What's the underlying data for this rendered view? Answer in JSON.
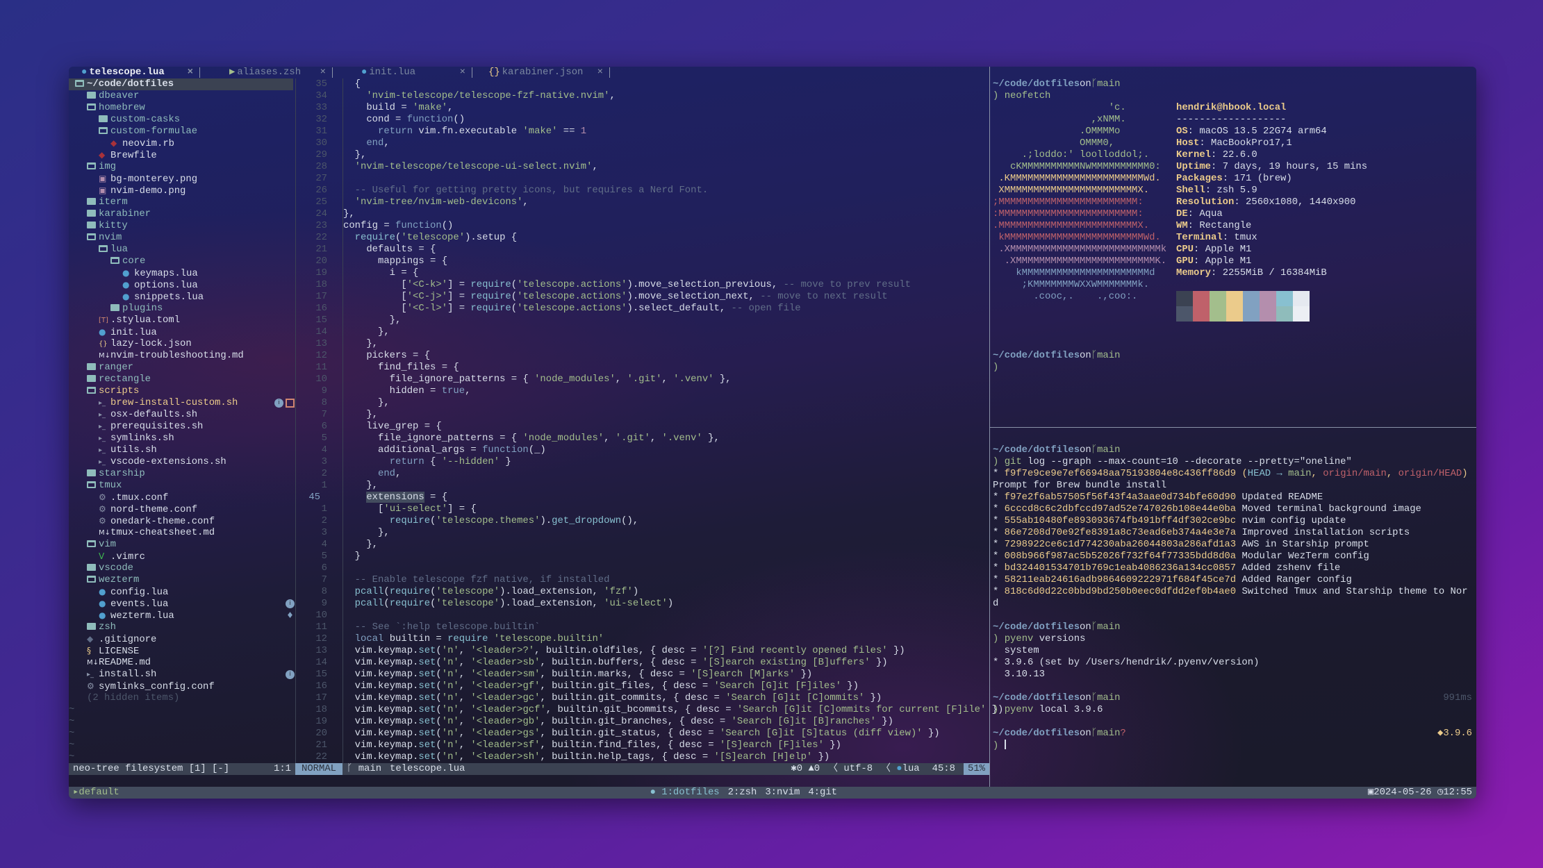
{
  "tabs": [
    {
      "label": "telescope.lua",
      "icon": "lua-icon",
      "active": true
    },
    {
      "label": "aliases.zsh",
      "icon": "terminal-icon",
      "active": false
    },
    {
      "label": "init.lua",
      "icon": "lua-icon",
      "active": false
    },
    {
      "label": "karabiner.json",
      "icon": "json-icon",
      "active": false
    }
  ],
  "tab_close_glyph": "×",
  "tree": {
    "items": [
      {
        "name": "~/code/dotfiles",
        "level": 0,
        "type": "root"
      },
      {
        "name": "dbeaver",
        "level": 1,
        "type": "dir"
      },
      {
        "name": "homebrew",
        "level": 1,
        "type": "dir-open"
      },
      {
        "name": "custom-casks",
        "level": 2,
        "type": "dir"
      },
      {
        "name": "custom-formulae",
        "level": 2,
        "type": "dir-open"
      },
      {
        "name": "neovim.rb",
        "level": 3,
        "type": "ruby"
      },
      {
        "name": "Brewfile",
        "level": 2,
        "type": "ruby"
      },
      {
        "name": "img",
        "level": 1,
        "type": "dir-open"
      },
      {
        "name": "bg-monterey.png",
        "level": 2,
        "type": "image"
      },
      {
        "name": "nvim-demo.png",
        "level": 2,
        "type": "image"
      },
      {
        "name": "iterm",
        "level": 1,
        "type": "dir"
      },
      {
        "name": "karabiner",
        "level": 1,
        "type": "dir"
      },
      {
        "name": "kitty",
        "level": 1,
        "type": "dir"
      },
      {
        "name": "nvim",
        "level": 1,
        "type": "dir-open"
      },
      {
        "name": "lua",
        "level": 2,
        "type": "dir-open"
      },
      {
        "name": "core",
        "level": 3,
        "type": "dir-open"
      },
      {
        "name": "keymaps.lua",
        "level": 4,
        "type": "lua"
      },
      {
        "name": "options.lua",
        "level": 4,
        "type": "lua"
      },
      {
        "name": "snippets.lua",
        "level": 4,
        "type": "lua"
      },
      {
        "name": "plugins",
        "level": 3,
        "type": "dir"
      },
      {
        "name": ".stylua.toml",
        "level": 2,
        "type": "toml"
      },
      {
        "name": "init.lua",
        "level": 2,
        "type": "lua"
      },
      {
        "name": "lazy-lock.json",
        "level": 2,
        "type": "json"
      },
      {
        "name": "nvim-troubleshooting.md",
        "level": 2,
        "type": "md"
      },
      {
        "name": "ranger",
        "level": 1,
        "type": "dir"
      },
      {
        "name": "rectangle",
        "level": 1,
        "type": "dir"
      },
      {
        "name": "scripts",
        "level": 1,
        "type": "dir-open",
        "modified": true
      },
      {
        "name": "brew-install-custom.sh",
        "level": 2,
        "type": "sh",
        "modified": true,
        "badges": [
          "info",
          "unsaved"
        ]
      },
      {
        "name": "osx-defaults.sh",
        "level": 2,
        "type": "sh"
      },
      {
        "name": "prerequisites.sh",
        "level": 2,
        "type": "sh"
      },
      {
        "name": "symlinks.sh",
        "level": 2,
        "type": "sh"
      },
      {
        "name": "utils.sh",
        "level": 2,
        "type": "sh"
      },
      {
        "name": "vscode-extensions.sh",
        "level": 2,
        "type": "sh"
      },
      {
        "name": "starship",
        "level": 1,
        "type": "dir"
      },
      {
        "name": "tmux",
        "level": 1,
        "type": "dir-open"
      },
      {
        "name": ".tmux.conf",
        "level": 2,
        "type": "conf"
      },
      {
        "name": "nord-theme.conf",
        "level": 2,
        "type": "conf"
      },
      {
        "name": "onedark-theme.conf",
        "level": 2,
        "type": "conf"
      },
      {
        "name": "tmux-cheatsheet.md",
        "level": 2,
        "type": "md"
      },
      {
        "name": "vim",
        "level": 1,
        "type": "dir-open"
      },
      {
        "name": ".vimrc",
        "level": 2,
        "type": "vim"
      },
      {
        "name": "vscode",
        "level": 1,
        "type": "dir"
      },
      {
        "name": "wezterm",
        "level": 1,
        "type": "dir-open"
      },
      {
        "name": "config.lua",
        "level": 2,
        "type": "lua"
      },
      {
        "name": "events.lua",
        "level": 2,
        "type": "lua",
        "badges": [
          "info"
        ]
      },
      {
        "name": "wezterm.lua",
        "level": 2,
        "type": "lua",
        "badges": [
          "hint"
        ]
      },
      {
        "name": "zsh",
        "level": 1,
        "type": "dir"
      },
      {
        "name": ".gitignore",
        "level": 1,
        "type": "git"
      },
      {
        "name": "LICENSE",
        "level": 1,
        "type": "license"
      },
      {
        "name": "README.md",
        "level": 1,
        "type": "md"
      },
      {
        "name": "install.sh",
        "level": 1,
        "type": "sh",
        "badges": [
          "info"
        ]
      },
      {
        "name": "symlinks_config.conf",
        "level": 1,
        "type": "conf"
      },
      {
        "name": "(2 hidden items)",
        "level": 1,
        "type": "hidden"
      }
    ],
    "filler": "~"
  },
  "editor": {
    "line_numbers": [
      35,
      34,
      33,
      32,
      31,
      30,
      29,
      28,
      27,
      26,
      25,
      24,
      23,
      22,
      21,
      20,
      19,
      18,
      17,
      16,
      15,
      14,
      13,
      12,
      11,
      10,
      9,
      8,
      7,
      6,
      5,
      4,
      3,
      2,
      1,
      45,
      1,
      2,
      3,
      4,
      5,
      6,
      7,
      8,
      9,
      10,
      11,
      12,
      13,
      14,
      15,
      16,
      17,
      18,
      19,
      20,
      21,
      22
    ],
    "cursor_line": 45,
    "cursor_word": "extensions",
    "lines": [
      "  {",
      "    'nvim-telescope/telescope-fzf-native.nvim',",
      "    build = 'make',",
      "    cond = function()",
      "      return vim.fn.executable 'make' == 1",
      "    end,",
      "  },",
      "  'nvim-telescope/telescope-ui-select.nvim',",
      "",
      "  -- Useful for getting pretty icons, but requires a Nerd Font.",
      "  'nvim-tree/nvim-web-devicons',",
      "},",
      "config = function()",
      "  require('telescope').setup {",
      "    defaults = {",
      "      mappings = {",
      "        i = {",
      "          ['<C-k>'] = require('telescope.actions').move_selection_previous, -- move to prev result",
      "          ['<C-j>'] = require('telescope.actions').move_selection_next, -- move to next result",
      "          ['<C-l>'] = require('telescope.actions').select_default, -- open file",
      "        },",
      "      },",
      "    },",
      "    pickers = {",
      "      find_files = {",
      "        file_ignore_patterns = { 'node_modules', '.git', '.venv' },",
      "        hidden = true,",
      "      },",
      "    },",
      "    live_grep = {",
      "      file_ignore_patterns = { 'node_modules', '.git', '.venv' },",
      "      additional_args = function(_)",
      "        return { '--hidden' }",
      "      end,",
      "    },",
      "    extensions = {",
      "      ['ui-select'] = {",
      "        require('telescope.themes').get_dropdown(),",
      "      },",
      "    },",
      "  }",
      "",
      "  -- Enable telescope fzf native, if installed",
      "  pcall(require('telescope').load_extension, 'fzf')",
      "  pcall(require('telescope').load_extension, 'ui-select')",
      "",
      "  -- See `:help telescope.builtin`",
      "  local builtin = require 'telescope.builtin'",
      "  vim.keymap.set('n', '<leader>?', builtin.oldfiles, { desc = '[?] Find recently opened files' })",
      "  vim.keymap.set('n', '<leader>sb', builtin.buffers, { desc = '[S]earch existing [B]uffers' })",
      "  vim.keymap.set('n', '<leader>sm', builtin.marks, { desc = '[S]earch [M]arks' })",
      "  vim.keymap.set('n', '<leader>gf', builtin.git_files, { desc = 'Search [G]it [F]iles' })",
      "  vim.keymap.set('n', '<leader>gc', builtin.git_commits, { desc = 'Search [G]it [C]ommits' })",
      "  vim.keymap.set('n', '<leader>gcf', builtin.git_bcommits, { desc = 'Search [G]it [C]ommits for current [F]ile' })",
      "  vim.keymap.set('n', '<leader>gb', builtin.git_branches, { desc = 'Search [G]it [B]ranches' })",
      "  vim.keymap.set('n', '<leader>gs', builtin.git_status, { desc = 'Search [G]it [S]tatus (diff view)' })",
      "  vim.keymap.set('n', '<leader>sf', builtin.find_files, { desc = '[S]earch [F]iles' })",
      "  vim.keymap.set('n', '<leader>sh', builtin.help_tags, { desc = '[S]earch [H]elp' })"
    ]
  },
  "nvim_status": {
    "tree_label": "neo-tree filesystem [1] [-]",
    "tree_pos": "1:1",
    "mode": "NORMAL",
    "branch": "main",
    "file": "telescope.lua",
    "errors": "0",
    "warnings": "0",
    "encoding": "utf-8",
    "filetype": "lua",
    "position": "45:8",
    "percent": "51%"
  },
  "prompt": {
    "path": "~/code/dotfiles",
    "on": "on",
    "branch": "main",
    "arrow": ")"
  },
  "pane_top": {
    "command": "neofetch",
    "logo": [
      {
        "t": "                    'c.",
        "color": "#a3be8c"
      },
      {
        "t": "                 ,xNMM.",
        "color": "#a3be8c"
      },
      {
        "t": "               .OMMMMo",
        "color": "#a3be8c"
      },
      {
        "t": "               OMMM0,",
        "color": "#a3be8c"
      },
      {
        "t": "     .;loddo:' loolloddol;.",
        "color": "#a3be8c"
      },
      {
        "t": "   cKMMMMMMMMMMNWMMMMMMMMMM0:",
        "color": "#a3be8c"
      },
      {
        "t": " .KMMMMMMMMMMMMMMMMMMMMMMMWd.",
        "color": "#ebcb8b"
      },
      {
        "t": " XMMMMMMMMMMMMMMMMMMMMMMMX.",
        "color": "#ebcb8b"
      },
      {
        "t": ";MMMMMMMMMMMMMMMMMMMMMMMM:",
        "color": "#bf616a"
      },
      {
        "t": ":MMMMMMMMMMMMMMMMMMMMMMMM:",
        "color": "#bf616a"
      },
      {
        "t": ".MMMMMMMMMMMMMMMMMMMMMMMMX.",
        "color": "#bf616a"
      },
      {
        "t": " kMMMMMMMMMMMMMMMMMMMMMMMMWd.",
        "color": "#bf616a"
      },
      {
        "t": " .XMMMMMMMMMMMMMMMMMMMMMMMMMMk",
        "color": "#b48ead"
      },
      {
        "t": "  .XMMMMMMMMMMMMMMMMMMMMMMMMK.",
        "color": "#b48ead"
      },
      {
        "t": "    kMMMMMMMMMMMMMMMMMMMMMMd",
        "color": "#81a1c1"
      },
      {
        "t": "     ;KMMMMMMMWXXWMMMMMMMk.",
        "color": "#81a1c1"
      },
      {
        "t": "       .cooc,.    .,coo:.",
        "color": "#81a1c1"
      }
    ],
    "user": "hendrik@hbook.local",
    "divider": "-------------------",
    "info": [
      {
        "label": "OS",
        "value": "macOS 13.5 22G74 arm64"
      },
      {
        "label": "Host",
        "value": "MacBookPro17,1"
      },
      {
        "label": "Kernel",
        "value": "22.6.0"
      },
      {
        "label": "Uptime",
        "value": "7 days, 19 hours, 15 mins"
      },
      {
        "label": "Packages",
        "value": "171 (brew)"
      },
      {
        "label": "Shell",
        "value": "zsh 5.9"
      },
      {
        "label": "Resolution",
        "value": "2560x1080, 1440x900"
      },
      {
        "label": "DE",
        "value": "Aqua"
      },
      {
        "label": "WM",
        "value": "Rectangle"
      },
      {
        "label": "Terminal",
        "value": "tmux"
      },
      {
        "label": "CPU",
        "value": "Apple M1"
      },
      {
        "label": "GPU",
        "value": "Apple M1"
      },
      {
        "label": "Memory",
        "value": "2255MiB / 16384MiB"
      }
    ],
    "palette_top": [
      "#3b4252",
      "#bf616a",
      "#a3be8c",
      "#ebcb8b",
      "#81a1c1",
      "#b48ead",
      "#88c0d0",
      "#e5e9f0"
    ],
    "palette_bottom": [
      "#4c566a",
      "#bf616a",
      "#a3be8c",
      "#ebcb8b",
      "#81a1c1",
      "#b48ead",
      "#8fbcbb",
      "#eceff4"
    ]
  },
  "pane_bottom": {
    "git_cmd": "git",
    "git_args": "log --graph --max-count=10 --decorate --pretty=\"oneline\"",
    "log": [
      {
        "hash": "f9f7e9ce9e7ef66948aa75193804e8c436ff86d9",
        "head": "HEAD",
        "arrow": "→",
        "local": "main",
        "remotes": [
          "origin/main",
          "origin/HEAD"
        ],
        "msg": "Prompt for Brew bundle install"
      },
      {
        "hash": "f97e2f6ab57505f56f43f4a3aae0d734bfe60d90",
        "msg": "Updated README"
      },
      {
        "hash": "6cccd8c6c2dbfccd97ad52e747026b108e44e0ba",
        "msg": "Moved terminal background image"
      },
      {
        "hash": "555ab10480fe893093674fb491bff4df302ce9bc",
        "msg": "nvim config update"
      },
      {
        "hash": "86e7208d70e92fe8391a8c73ead6eb374a4e3e7a",
        "msg": "Improved installation scripts"
      },
      {
        "hash": "7298922ce6c1d774230aba26044803a286afd1a3",
        "msg": "AWS in Starship prompt"
      },
      {
        "hash": "008b966f987ac5b52026f732f64f77335bdd8d0a",
        "msg": "Modular WezTerm config"
      },
      {
        "hash": "bd324401534701b769c1eab4086236a134cc0857",
        "msg": "Added zshenv file"
      },
      {
        "hash": "58211eab24616adb9864609222971f684f45ce7d",
        "msg": "Added Ranger config"
      },
      {
        "hash": "818c6d0d22c0bbd9bd250b0eec0dfdd2ef0b4ae0",
        "msg": "Switched Tmux and Starship theme to Nord"
      }
    ],
    "pyenv_cmd": "pyenv",
    "pyenv_args1": "versions",
    "versions": [
      "  system",
      "* 3.9.6 (set by /Users/hendrik/.pyenv/version)",
      "  3.10.13"
    ],
    "duration": "991ms",
    "pyenv_args2": "local 3.9.6",
    "untracked": "?",
    "python_version": "3.9.6"
  },
  "tmux": {
    "session": "default",
    "windows": [
      {
        "label": "1:dotfiles",
        "active": true
      },
      {
        "label": "2:zsh",
        "active": false
      },
      {
        "label": "3:nvim",
        "active": false
      },
      {
        "label": "4:git",
        "active": false
      }
    ],
    "date": "2024-05-26",
    "time": "12:55"
  }
}
